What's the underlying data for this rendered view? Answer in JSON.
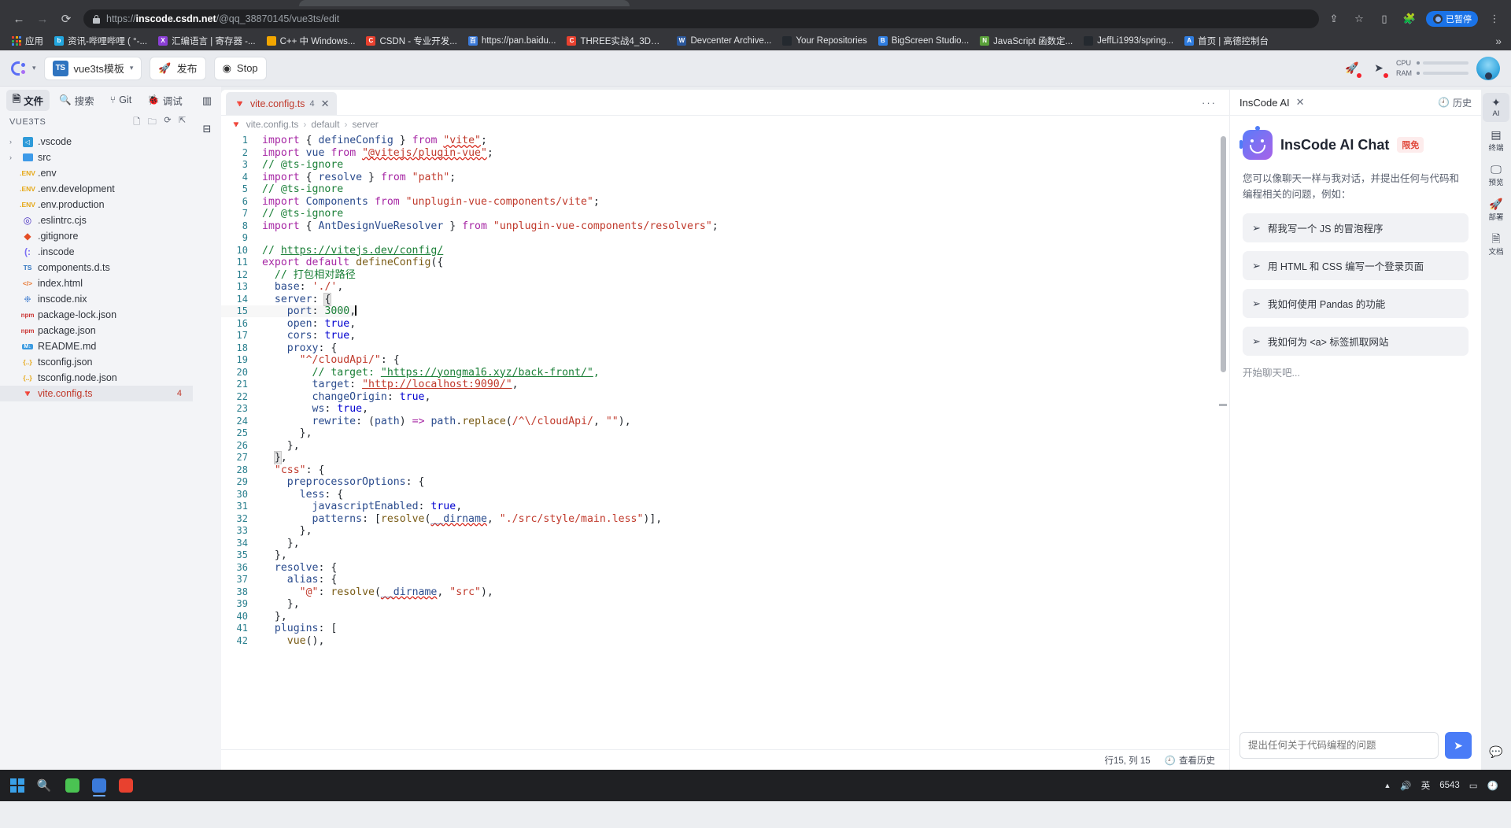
{
  "browser": {
    "url_prefix": "https://",
    "url_host": "inscode.csdn.net",
    "url_path": "/@qq_38870145/vue3ts/edit",
    "back_icon": "back-arrow-icon",
    "forward_icon": "forward-arrow-icon",
    "reload_icon": "reload-icon",
    "share_icon": "share-icon",
    "star_icon": "star-icon",
    "sidepanel_icon": "side-panel-icon",
    "puzzle_icon": "extensions-icon",
    "menu_icon": "kebab-menu-icon",
    "paused_label": "已暂停"
  },
  "bookmarks": {
    "apps_label": "应用",
    "overflow_label": "»",
    "items": [
      {
        "label": "资讯-哔哩哔哩 ( °-...",
        "favicon": "bilibili-icon",
        "color": "#22a7e0",
        "glyph": "b"
      },
      {
        "label": "汇编语言 | 寄存器 -...",
        "favicon": "vs-icon",
        "color": "#8b3fd6",
        "glyph": "X"
      },
      {
        "label": "C++ 中 Windows...",
        "favicon": "microsoft-icon",
        "color": "#f2a600",
        "glyph": ""
      },
      {
        "label": "CSDN - 专业开发...",
        "favicon": "csdn-icon",
        "color": "#e8412f",
        "glyph": "C"
      },
      {
        "label": "https://pan.baidu...",
        "favicon": "baidu-icon",
        "color": "#3b7ad9",
        "glyph": "百"
      },
      {
        "label": "THREE实战4_3D纹...",
        "favicon": "csdn-icon",
        "color": "#e8412f",
        "glyph": "C"
      },
      {
        "label": "Devcenter Archive...",
        "favicon": "word-icon",
        "color": "#2b579a",
        "glyph": "W"
      },
      {
        "label": "Your Repositories",
        "favicon": "github-icon",
        "color": "#24292f",
        "glyph": ""
      },
      {
        "label": "BigScreen Studio...",
        "favicon": "bigscreen-icon",
        "color": "#2f7de0",
        "glyph": "B"
      },
      {
        "label": "JavaScript 函数定...",
        "favicon": "node-icon",
        "color": "#5aa03a",
        "glyph": "N"
      },
      {
        "label": "JeffLi1993/spring...",
        "favicon": "github-icon",
        "color": "#24292f",
        "glyph": ""
      },
      {
        "label": "首页 | 高德控制台",
        "favicon": "amap-icon",
        "color": "#2f7de0",
        "glyph": "A"
      }
    ]
  },
  "toolbar": {
    "logo_icon": "inscode-logo-icon",
    "project_name": "vue3ts模板",
    "project_type_badge": "TS",
    "publish_label": "发布",
    "publish_icon": "rocket-icon",
    "stop_label": "Stop",
    "stop_icon": "stop-circle-icon",
    "cpu_label": "CPU",
    "ram_label": "RAM",
    "share_icon": "share-node-icon",
    "cursor_icon": "cursor-pointer-icon",
    "avatar": "user-avatar"
  },
  "sidebar": {
    "tabs": [
      {
        "label": "文件",
        "icon": "file-icon",
        "active": true
      },
      {
        "label": "搜索",
        "icon": "search-icon",
        "active": false
      },
      {
        "label": "Git",
        "icon": "git-branch-icon",
        "active": false
      },
      {
        "label": "调试",
        "icon": "bug-icon",
        "active": false
      }
    ],
    "root_label": "VUE3TS",
    "actions": [
      {
        "icon": "new-file-icon"
      },
      {
        "icon": "new-folder-icon"
      },
      {
        "icon": "refresh-icon"
      },
      {
        "icon": "collapse-all-icon"
      }
    ],
    "files": [
      {
        "label": ".vscode",
        "kind": "folder-vscode",
        "expandable": true,
        "badge": ""
      },
      {
        "label": "src",
        "kind": "folder",
        "expandable": true,
        "badge": ""
      },
      {
        "label": ".env",
        "kind": "env",
        "expandable": false,
        "badge": ""
      },
      {
        "label": ".env.development",
        "kind": "env",
        "expandable": false,
        "badge": ""
      },
      {
        "label": ".env.production",
        "kind": "env",
        "expandable": false,
        "badge": ""
      },
      {
        "label": ".eslintrc.cjs",
        "kind": "eslint",
        "expandable": false,
        "badge": ""
      },
      {
        "label": ".gitignore",
        "kind": "git",
        "expandable": false,
        "badge": ""
      },
      {
        "label": ".inscode",
        "kind": "inscode",
        "expandable": false,
        "badge": ""
      },
      {
        "label": "components.d.ts",
        "kind": "ts",
        "expandable": false,
        "badge": ""
      },
      {
        "label": "index.html",
        "kind": "html",
        "expandable": false,
        "badge": ""
      },
      {
        "label": "inscode.nix",
        "kind": "nix",
        "expandable": false,
        "badge": ""
      },
      {
        "label": "package-lock.json",
        "kind": "npm",
        "expandable": false,
        "badge": ""
      },
      {
        "label": "package.json",
        "kind": "npm",
        "expandable": false,
        "badge": ""
      },
      {
        "label": "README.md",
        "kind": "md",
        "expandable": false,
        "badge": ""
      },
      {
        "label": "tsconfig.json",
        "kind": "json",
        "expandable": false,
        "badge": ""
      },
      {
        "label": "tsconfig.node.json",
        "kind": "json",
        "expandable": false,
        "badge": ""
      },
      {
        "label": "vite.config.ts",
        "kind": "vite",
        "expandable": false,
        "badge": "4",
        "selected": true
      }
    ]
  },
  "activity_rail": [
    {
      "icon": "split-layout-icon"
    },
    {
      "icon": "collapse-panel-icon"
    }
  ],
  "editor": {
    "tab": {
      "filename": "vite.config.ts",
      "problem_count": "4",
      "icon": "vite-icon",
      "close_icon": "close-icon"
    },
    "tabbar_more_icon": "more-horizontal-icon",
    "breadcrumb": [
      "vite.config.ts",
      "default",
      "server"
    ],
    "code_language": "typescript",
    "cursor_line": "15",
    "total_lines": "42",
    "status": {
      "position": "行15, 列 15",
      "history_label": "查看历史",
      "history_icon": "history-clock-icon"
    }
  },
  "ai": {
    "panel_title": "InsCode AI",
    "close_icon": "close-icon",
    "history_label": "历史",
    "history_icon": "history-clock-icon",
    "bot_icon": "robot-avatar-icon",
    "heading": "InsCode AI Chat",
    "free_badge": "限免",
    "intro": "您可以像聊天一样与我对话，并提出任何与代码和编程相关的问题，例如：",
    "suggestions": [
      {
        "text": "帮我写一个 JS 的冒泡程序",
        "icon": "send-icon"
      },
      {
        "text": "用 HTML 和 CSS 编写一个登录页面",
        "icon": "send-icon"
      },
      {
        "text": "我如何使用 Pandas 的功能",
        "icon": "send-icon"
      },
      {
        "text": "我如何为 <a> 标签抓取网站",
        "icon": "send-icon"
      }
    ],
    "start_hint": "开始聊天吧...",
    "input_placeholder": "提出任何关于代码编程的问题",
    "send_icon": "send-plane-icon"
  },
  "right_rail": [
    {
      "label": "AI",
      "icon": "ai-chat-icon",
      "active": true
    },
    {
      "label": "终端",
      "icon": "terminal-icon",
      "active": false
    },
    {
      "label": "预览",
      "icon": "monitor-preview-icon",
      "active": false
    },
    {
      "label": "部署",
      "icon": "rocket-deploy-icon",
      "active": false
    },
    {
      "label": "文档",
      "icon": "document-icon",
      "active": false
    },
    {
      "label": "",
      "icon": "chat-bubble-icon",
      "active": false
    }
  ],
  "taskbar": {
    "start_icon": "windows-start-icon",
    "search_icon": "search-icon",
    "apps": [
      {
        "icon": "wechat-icon",
        "color": "#4ac352",
        "active": false
      },
      {
        "icon": "chrome-icon",
        "color": "#3b7ad9",
        "active": true
      },
      {
        "icon": "wps-icon",
        "color": "#e8412f",
        "active": false
      }
    ],
    "tray": {
      "chevron": "▲",
      "sound_icon": "speaker-icon",
      "ime_label": "英",
      "number": "6543",
      "battery_icon": "battery-icon",
      "clock_icon": "clock-icon"
    }
  },
  "code": {
    "lines": [
      {
        "n": "1",
        "html": "<span class='kw'>import</span> <span class='punc'>{</span> <span class='var'>defineConfig</span> <span class='punc'>}</span> <span class='kw'>from</span> <span class='str sq-red'>\"vite\"</span><span class='punc'>;</span>"
      },
      {
        "n": "2",
        "html": "<span class='kw'>import</span> <span class='var'>vue</span> <span class='kw'>from</span> <span class='str sq-red'>\"@vitejs/plugin-vue\"</span><span class='punc'>;</span>"
      },
      {
        "n": "3",
        "html": "<span class='com'>// @ts-ignore</span>"
      },
      {
        "n": "4",
        "html": "<span class='kw'>import</span> <span class='punc'>{</span> <span class='var'>resolve</span> <span class='punc'>}</span> <span class='kw'>from</span> <span class='str'>\"path\"</span><span class='punc'>;</span>"
      },
      {
        "n": "5",
        "html": "<span class='com'>// @ts-ignore</span>"
      },
      {
        "n": "6",
        "html": "<span class='kw'>import</span> <span class='var'>Components</span> <span class='kw'>from</span> <span class='str'>\"unplugin-vue-components/vite\"</span><span class='punc'>;</span>"
      },
      {
        "n": "7",
        "html": "<span class='com'>// @ts-ignore</span>"
      },
      {
        "n": "8",
        "html": "<span class='kw'>import</span> <span class='punc'>{</span> <span class='var'>AntDesignVueResolver</span> <span class='punc'>}</span> <span class='kw'>from</span> <span class='str'>\"unplugin-vue-components/resolvers\"</span><span class='punc'>;</span>"
      },
      {
        "n": "9",
        "html": ""
      },
      {
        "n": "10",
        "html": "<span class='com'>// <span class='ul-grn'>https://vitejs.dev/config/</span></span>"
      },
      {
        "n": "11",
        "html": "<span class='kw'>export</span> <span class='kw'>default</span> <span class='fn'>defineConfig</span><span class='punc'>({</span>"
      },
      {
        "n": "12",
        "html": "  <span class='com'>// 打包相对路径</span>"
      },
      {
        "n": "13",
        "html": "  <span class='prop'>base</span><span class='punc'>:</span> <span class='str'>'./'</span><span class='punc'>,</span>"
      },
      {
        "n": "14",
        "html": "  <span class='prop'>server</span><span class='punc'>:</span> <span class='punc bracket-hl'>{</span>"
      },
      {
        "n": "15",
        "html": "    <span class='prop'>port</span><span class='punc'>:</span> <span class='num2'>3000</span><span class='punc'>,</span><span class='cursor-bar'></span>",
        "highlight": true
      },
      {
        "n": "16",
        "html": "    <span class='prop'>open</span><span class='punc'>:</span> <span class='kw2'>true</span><span class='punc'>,</span>"
      },
      {
        "n": "17",
        "html": "    <span class='prop'>cors</span><span class='punc'>:</span> <span class='kw2'>true</span><span class='punc'>,</span>"
      },
      {
        "n": "18",
        "html": "    <span class='prop'>proxy</span><span class='punc'>:</span> <span class='punc'>{</span>"
      },
      {
        "n": "19",
        "html": "      <span class='str'>\"^/cloudApi/\"</span><span class='punc'>:</span> <span class='punc'>{</span>"
      },
      {
        "n": "20",
        "html": "        <span class='com'>// target: <span class='ul-grn'>\"https://yongma16.xyz/back-front/\"</span>,</span>"
      },
      {
        "n": "21",
        "html": "        <span class='prop'>target</span><span class='punc'>:</span> <span class='str'><span class='ul-red'>\"http://localhost:9090/\"</span></span><span class='punc'>,</span>"
      },
      {
        "n": "22",
        "html": "        <span class='prop'>changeOrigin</span><span class='punc'>:</span> <span class='kw2'>true</span><span class='punc'>,</span>"
      },
      {
        "n": "23",
        "html": "        <span class='prop'>ws</span><span class='punc'>:</span> <span class='kw2'>true</span><span class='punc'>,</span>"
      },
      {
        "n": "24",
        "html": "        <span class='prop'>rewrite</span><span class='punc'>:</span> <span class='punc'>(</span><span class='var'>path</span><span class='punc'>)</span> <span class='kw'>=&gt;</span> <span class='var'>path</span><span class='punc'>.</span><span class='fn'>replace</span><span class='punc'>(</span><span class='str'>/^\\/cloudApi/</span><span class='punc'>,</span> <span class='str'>\"\"</span><span class='punc'>),</span>"
      },
      {
        "n": "25",
        "html": "      <span class='punc'>},</span>"
      },
      {
        "n": "26",
        "html": "    <span class='punc'>},</span>"
      },
      {
        "n": "27",
        "html": "  <span class='punc bracket-hl'>}</span><span class='punc'>,</span>"
      },
      {
        "n": "28",
        "html": "  <span class='str'>\"css\"</span><span class='punc'>: {</span>"
      },
      {
        "n": "29",
        "html": "    <span class='prop'>preprocessorOptions</span><span class='punc'>: {</span>"
      },
      {
        "n": "30",
        "html": "      <span class='prop'>less</span><span class='punc'>: {</span>"
      },
      {
        "n": "31",
        "html": "        <span class='prop'>javascriptEnabled</span><span class='punc'>:</span> <span class='kw2'>true</span><span class='punc'>,</span>"
      },
      {
        "n": "32",
        "html": "        <span class='prop'>patterns</span><span class='punc'>: [</span><span class='fn'>resolve</span><span class='punc'>(</span><span class='var sq-red'>__dirname</span><span class='punc'>,</span> <span class='str'>\"./src/style/main.less\"</span><span class='punc'>)],</span>"
      },
      {
        "n": "33",
        "html": "      <span class='punc'>},</span>"
      },
      {
        "n": "34",
        "html": "    <span class='punc'>},</span>"
      },
      {
        "n": "35",
        "html": "  <span class='punc'>},</span>"
      },
      {
        "n": "36",
        "html": "  <span class='prop'>resolve</span><span class='punc'>: {</span>"
      },
      {
        "n": "37",
        "html": "    <span class='prop'>alias</span><span class='punc'>: {</span>"
      },
      {
        "n": "38",
        "html": "      <span class='str'>\"@\"</span><span class='punc'>:</span> <span class='fn'>resolve</span><span class='punc'>(</span><span class='var sq-red'>__dirname</span><span class='punc'>,</span> <span class='str'>\"src\"</span><span class='punc'>),</span>"
      },
      {
        "n": "39",
        "html": "    <span class='punc'>},</span>"
      },
      {
        "n": "40",
        "html": "  <span class='punc'>},</span>"
      },
      {
        "n": "41",
        "html": "  <span class='prop'>plugins</span><span class='punc'>: [</span>"
      },
      {
        "n": "42",
        "html": "    <span class='fn'>vue</span><span class='punc'>(),</span>"
      }
    ]
  }
}
